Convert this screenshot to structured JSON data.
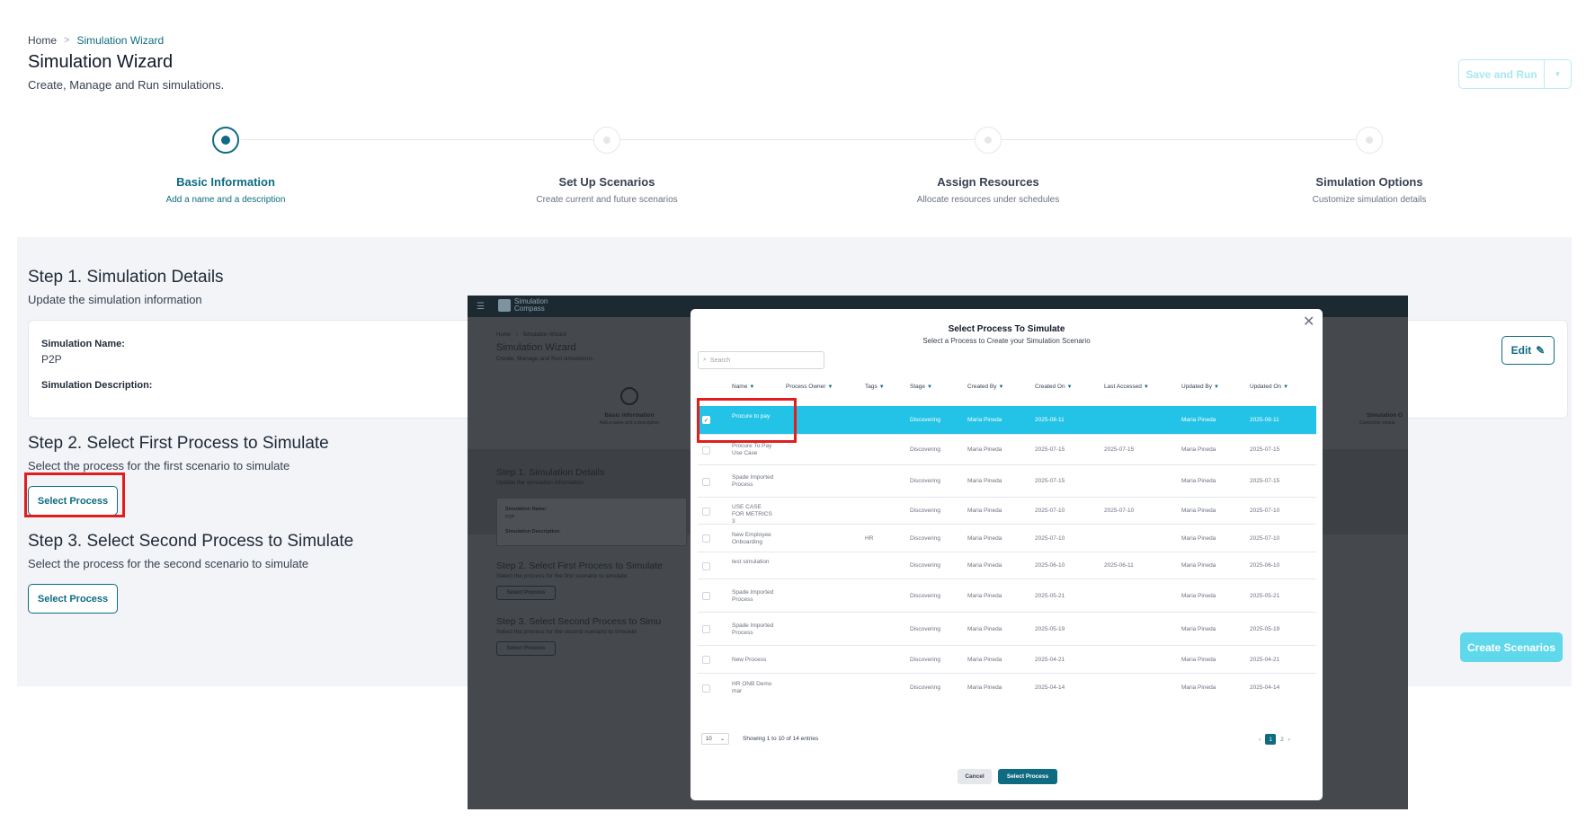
{
  "breadcrumb": {
    "home": "Home",
    "separator": ">",
    "current": "Simulation Wizard"
  },
  "header": {
    "title": "Simulation Wizard",
    "subtitle": "Create, Manage and Run simulations.",
    "save_run": "Save and Run"
  },
  "stepper": [
    {
      "title": "Basic Information",
      "desc": "Add a name and a description",
      "active": true
    },
    {
      "title": "Set Up Scenarios",
      "desc": "Create current and future scenarios",
      "active": false
    },
    {
      "title": "Assign Resources",
      "desc": "Allocate resources under schedules",
      "active": false
    },
    {
      "title": "Simulation Options",
      "desc": "Customize simulation details",
      "active": false
    }
  ],
  "step1": {
    "title": "Step 1. Simulation Details",
    "subtitle": "Update the simulation information",
    "name_label": "Simulation Name:",
    "name_value": "P2P",
    "desc_label": "Simulation Description:",
    "edit": "Edit"
  },
  "step2": {
    "title": "Step 2. Select First Process to Simulate",
    "subtitle": "Select the process for the first scenario to simulate",
    "button": "Select Process"
  },
  "step3": {
    "title": "Step 3. Select Second Process to Simulate",
    "subtitle": "Select the process for the second scenario to simulate",
    "button": "Select Process"
  },
  "create_scenarios": "Create Scenarios",
  "embed": {
    "logo": "Simulation Compass",
    "breadcrumb_home": "Home",
    "breadcrumb_current": "Simulation Wizard",
    "title": "Simulation Wizard",
    "subtitle": "Create, Manage and Run simulations.",
    "step_label": "Basic Information",
    "step_desc": "Add a name and a description",
    "step_right": "Simulation O",
    "step_right_desc": "Customize simula",
    "step1_title": "Step 1. Simulation Details",
    "step1_sub": "Update the simulation information",
    "name_label": "Simulation Name:",
    "name_value": "P2P",
    "desc_label": "Simulation Description:",
    "step2_title": "Step 2. Select First Process to Simulate",
    "step2_sub": "Select the process for the first scenario to simulate",
    "step3_title": "Step 3. Select Second Process to Simu",
    "step3_sub": "Select the process for the second scenario to simulate",
    "button": "Select Process"
  },
  "modal": {
    "title": "Select Process To Simulate",
    "subtitle": "Select a Process to Create your Simulation Scenario",
    "search_placeholder": "Search",
    "columns": [
      "Name",
      "Process Owner",
      "Tags",
      "Stage",
      "Created By",
      "Created On",
      "Last Accessed",
      "Updated By",
      "Updated On"
    ],
    "rows": [
      {
        "name": "Procure to pay",
        "owner": "",
        "tags": "",
        "stage": "Discovering",
        "created_by": "Maria Pineda",
        "created_on": "2025-08-11",
        "last_accessed": "",
        "updated_by": "Maria Pineda",
        "updated_on": "2025-08-11",
        "selected": true
      },
      {
        "name": "Procure To Pay Use Case",
        "owner": "",
        "tags": "",
        "stage": "Discovering",
        "created_by": "Maria Pineda",
        "created_on": "2025-07-15",
        "last_accessed": "2025-07-15",
        "updated_by": "Maria Pineda",
        "updated_on": "2025-07-15",
        "selected": false
      },
      {
        "name": "Spade Imported Process",
        "owner": "",
        "tags": "",
        "stage": "Discovering",
        "created_by": "Maria Pineda",
        "created_on": "2025-07-15",
        "last_accessed": "",
        "updated_by": "Maria Pineda",
        "updated_on": "2025-07-15",
        "selected": false
      },
      {
        "name": "USE CASE FOR METRICS 3",
        "owner": "",
        "tags": "",
        "stage": "Discovering",
        "created_by": "Maria Pineda",
        "created_on": "2025-07-10",
        "last_accessed": "2025-07-10",
        "updated_by": "Maria Pineda",
        "updated_on": "2025-07-10",
        "selected": false
      },
      {
        "name": "New Employee Onboarding",
        "owner": "",
        "tags": "HR",
        "stage": "Discovering",
        "created_by": "Maria Pineda",
        "created_on": "2025-07-10",
        "last_accessed": "",
        "updated_by": "Maria Pineda",
        "updated_on": "2025-07-10",
        "selected": false
      },
      {
        "name": "test simulation",
        "owner": "",
        "tags": "",
        "stage": "Discovering",
        "created_by": "Maria Pineda",
        "created_on": "2025-06-10",
        "last_accessed": "2025-06-11",
        "updated_by": "Maria Pineda",
        "updated_on": "2025-06-10",
        "selected": false
      },
      {
        "name": "Spade Imported Process",
        "owner": "",
        "tags": "",
        "stage": "Discovering",
        "created_by": "Maria Pineda",
        "created_on": "2025-05-21",
        "last_accessed": "",
        "updated_by": "Maria Pineda",
        "updated_on": "2025-05-21",
        "selected": false
      },
      {
        "name": "Spade Imported Process",
        "owner": "",
        "tags": "",
        "stage": "Discovering",
        "created_by": "Maria Pineda",
        "created_on": "2025-05-19",
        "last_accessed": "",
        "updated_by": "Maria Pineda",
        "updated_on": "2025-05-19",
        "selected": false
      },
      {
        "name": "New Process",
        "owner": "",
        "tags": "",
        "stage": "Discovering",
        "created_by": "Maria Pineda",
        "created_on": "2025-04-21",
        "last_accessed": "",
        "updated_by": "Maria Pineda",
        "updated_on": "2025-04-21",
        "selected": false
      },
      {
        "name": "HR ONB Demo mar",
        "owner": "",
        "tags": "",
        "stage": "Discovering",
        "created_by": "Maria Pineda",
        "created_on": "2025-04-14",
        "last_accessed": "",
        "updated_by": "Maria Pineda",
        "updated_on": "2025-04-14",
        "selected": false
      }
    ],
    "page_size": "10",
    "showing": "Showing 1 to 10 of 14 entries",
    "pages": [
      "1",
      "2"
    ],
    "current_page": "1",
    "cancel": "Cancel",
    "select": "Select Process"
  },
  "icons": {
    "edit": "pencil-icon",
    "close": "close-icon",
    "search": "search-icon",
    "filter": "filter-icon",
    "chevron": "chevron-down-icon"
  },
  "colors": {
    "accent": "#0e6b82",
    "selected_row": "#22c3e6",
    "highlight": "#e11d1d",
    "create_button": "#5fd8ec"
  }
}
